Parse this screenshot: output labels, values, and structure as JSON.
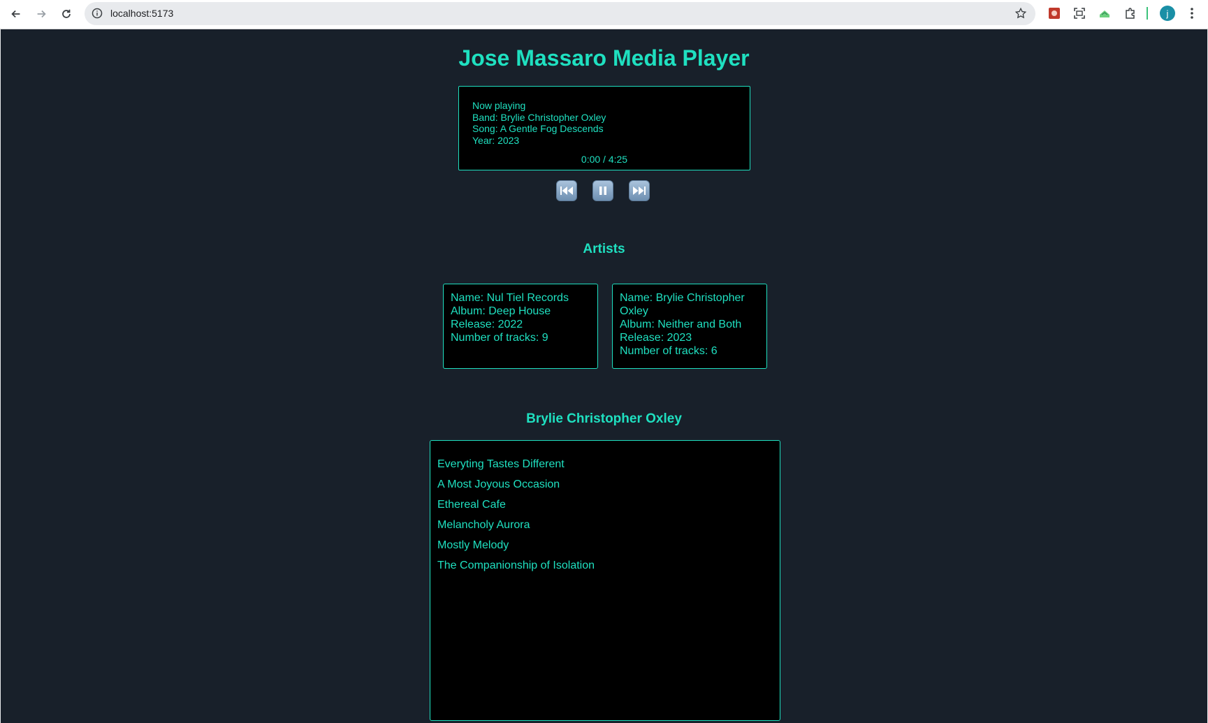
{
  "browser": {
    "url": "localhost:5173",
    "avatar_initial": "j",
    "icons": [
      "back-icon",
      "forward-icon",
      "reload-icon",
      "info-icon",
      "star-icon",
      "extension-red-icon",
      "screenshot-icon",
      "extension-green-icon",
      "puzzle-icon",
      "menu-dots-icon"
    ]
  },
  "app": {
    "title": "Jose Massaro Media Player",
    "now_playing": {
      "heading": "Now playing",
      "band": "Band: Brylie Christopher Oxley",
      "song": "Song: A Gentle Fog Descends",
      "year": "Year: 2023",
      "time": "0:00 / 4:25"
    },
    "controls": {
      "previous": "previous-track-icon",
      "pause": "pause-icon",
      "next": "next-track-icon"
    },
    "artists_heading": "Artists",
    "artists": [
      {
        "name": "Name: Nul Tiel Records",
        "album": "Album: Deep House",
        "release": "Release: 2022",
        "tracks": "Number of tracks: 9"
      },
      {
        "name": "Name: Brylie Christopher Oxley",
        "album": "Album: Neither and Both",
        "release": "Release: 2023",
        "tracks": "Number of tracks: 6"
      }
    ],
    "selected_artist": "Brylie Christopher Oxley",
    "track_list": [
      "Everyting Tastes Different",
      "A Most Joyous Occasion",
      "Ethereal Cafe",
      "Melancholy Aurora",
      "Mostly Melody",
      "The Companionship of Isolation"
    ],
    "colors": {
      "accent": "#1fe0c0",
      "background": "#18202a",
      "panel": "#000000"
    }
  }
}
